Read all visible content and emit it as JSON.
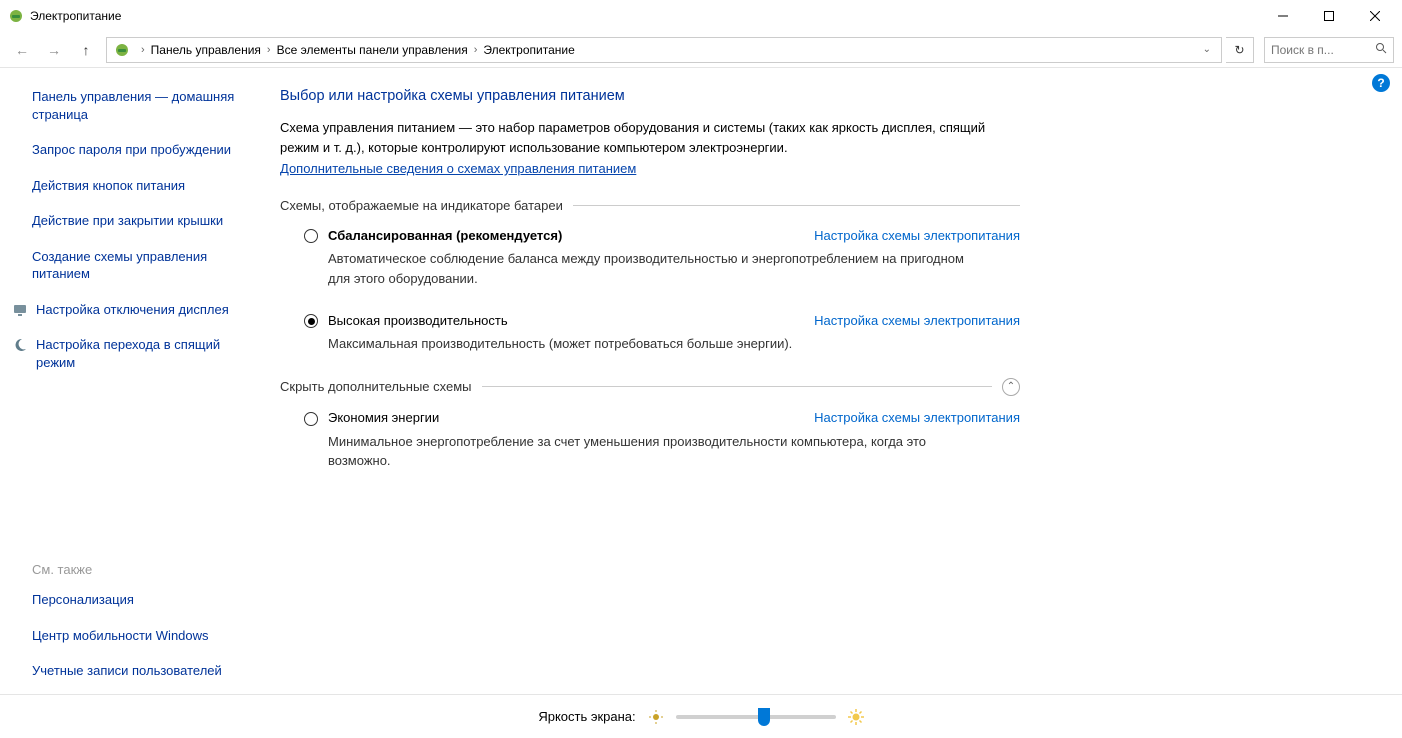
{
  "window": {
    "title": "Электропитание"
  },
  "breadcrumb": {
    "items": [
      "Панель управления",
      "Все элементы панели управления",
      "Электропитание"
    ]
  },
  "search": {
    "placeholder": "Поиск в п..."
  },
  "sidebar": {
    "home": "Панель управления — домашняя страница",
    "links": [
      "Запрос пароля при пробуждении",
      "Действия кнопок питания",
      "Действие при закрытии крышки",
      "Создание схемы управления питанием"
    ],
    "icon_links": [
      {
        "label": "Настройка отключения дисплея",
        "icon": "monitor-icon"
      },
      {
        "label": "Настройка перехода в спящий режим",
        "icon": "moon-icon"
      }
    ],
    "see_also_label": "См. также",
    "see_also": [
      "Персонализация",
      "Центр мобильности Windows",
      "Учетные записи пользователей"
    ]
  },
  "main": {
    "heading": "Выбор или настройка схемы управления питанием",
    "description": "Схема управления питанием — это набор параметров оборудования и системы (таких как яркость дисплея, спящий режим и т. д.), которые контролируют использование компьютером электроэнергии.",
    "more_link": "Дополнительные сведения о схемах управления питанием",
    "group1_title": "Схемы, отображаемые на индикаторе батареи",
    "group2_title": "Скрыть дополнительные схемы",
    "settings_link_label": "Настройка схемы электропитания",
    "plans": [
      {
        "name": "Сбалансированная (рекомендуется)",
        "bold": true,
        "selected": false,
        "desc": "Автоматическое соблюдение баланса между производительностью и энергопотреблением на пригодном для этого оборудовании."
      },
      {
        "name": "Высокая производительность",
        "bold": false,
        "selected": true,
        "desc": "Максимальная производительность (может потребоваться больше энергии)."
      }
    ],
    "extra_plans": [
      {
        "name": "Экономия энергии",
        "bold": false,
        "selected": false,
        "desc": "Минимальное энергопотребление за счет уменьшения производительности компьютера, когда это возможно."
      }
    ]
  },
  "footer": {
    "brightness_label": "Яркость экрана:"
  }
}
